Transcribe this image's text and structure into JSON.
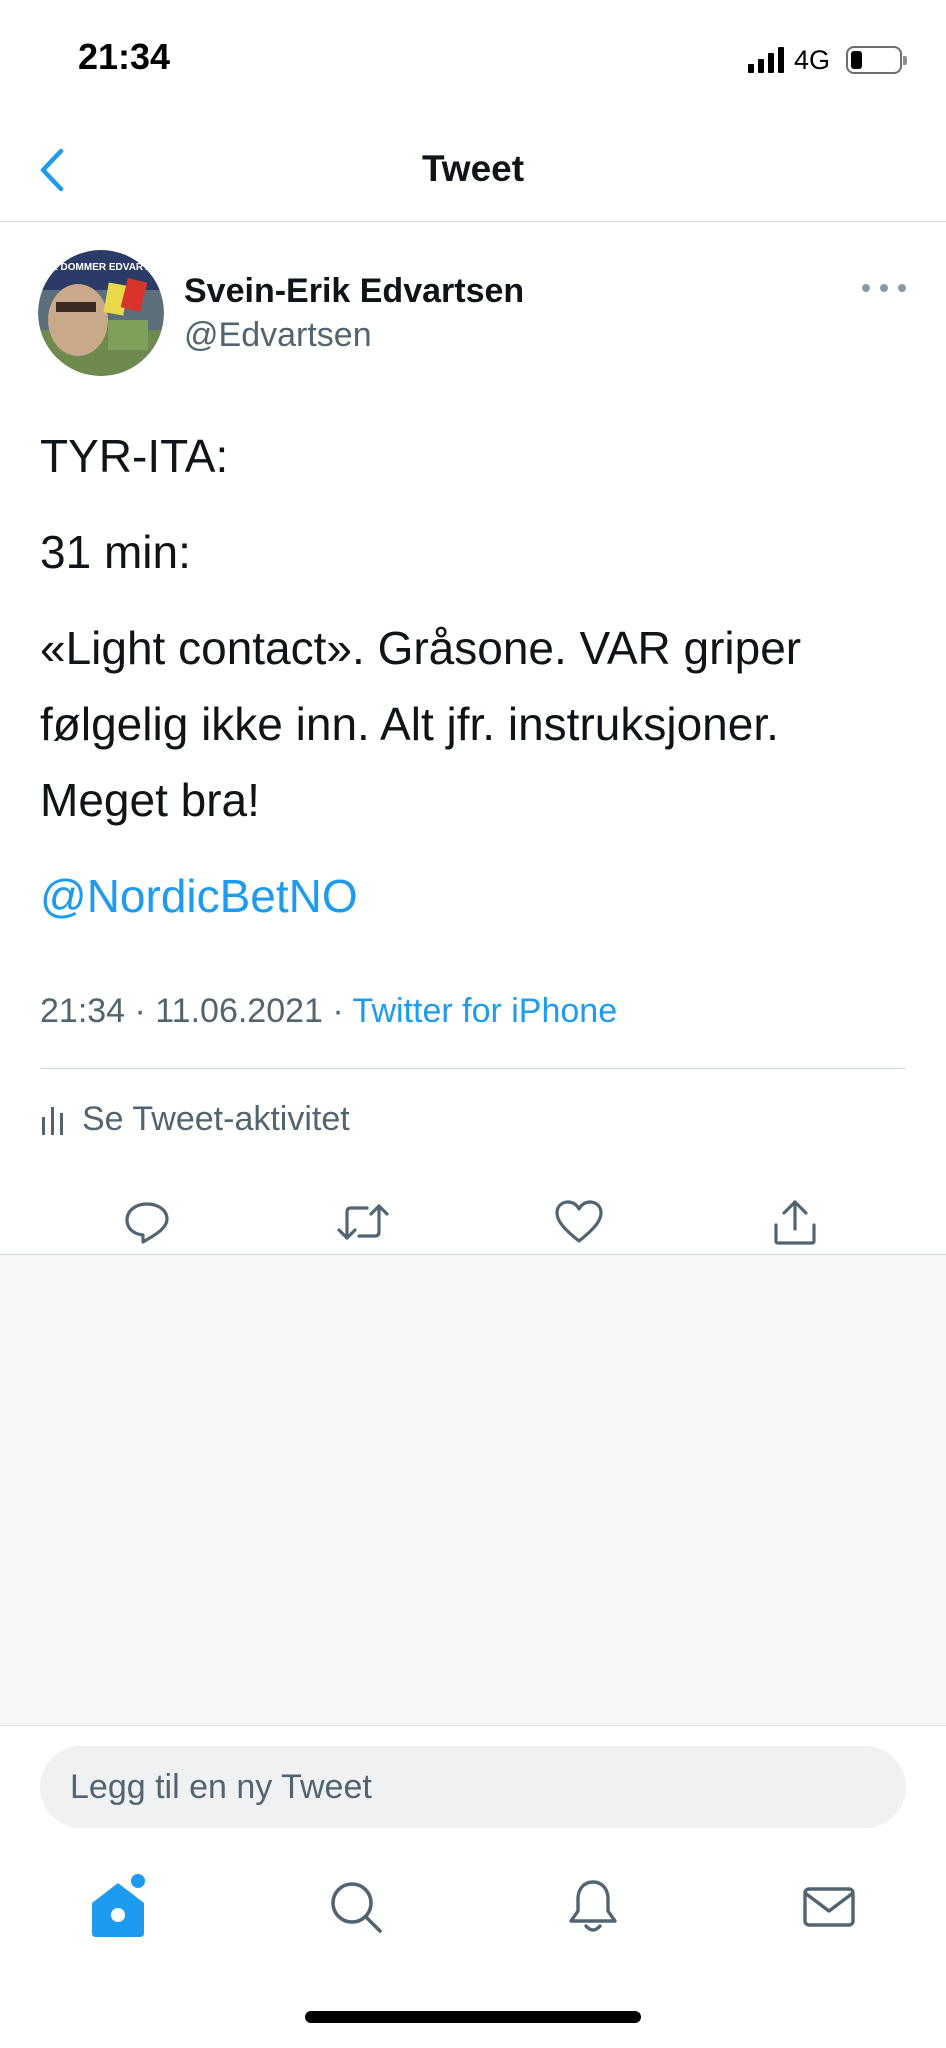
{
  "status_bar": {
    "time": "21:34",
    "network": "4G",
    "battery_level": 0.25
  },
  "header": {
    "title": "Tweet",
    "back_icon": "chevron-left-icon"
  },
  "tweet": {
    "author_name": "Svein-Erik Edvartsen",
    "author_handle": "@Edvartsen",
    "avatar_caption": "KOR E DOMMER EDVARTSEN?",
    "text_lines": [
      "TYR-ITA:",
      "31 min:",
      "«Light contact». Gråsone. VAR griper følgelig ikke inn. Alt jfr. instruksjoner. Meget bra!"
    ],
    "mention": "@NordicBetNO",
    "timestamp": "21:34 · 11.06.2021 · ",
    "source": "Twitter for iPhone",
    "activity_label": "Se Tweet-aktivitet",
    "actions": [
      "reply-icon",
      "retweet-icon",
      "like-icon",
      "share-icon"
    ]
  },
  "compose": {
    "placeholder": "Legg til en ny Tweet"
  },
  "tab_bar": {
    "tabs": [
      "home-icon",
      "search-icon",
      "notifications-icon",
      "messages-icon"
    ],
    "active": "home-icon"
  },
  "colors": {
    "accent": "#1d9bf0",
    "secondary_text": "#536471",
    "divider": "#cfd9de",
    "empty_background": "#f5f7f9"
  }
}
